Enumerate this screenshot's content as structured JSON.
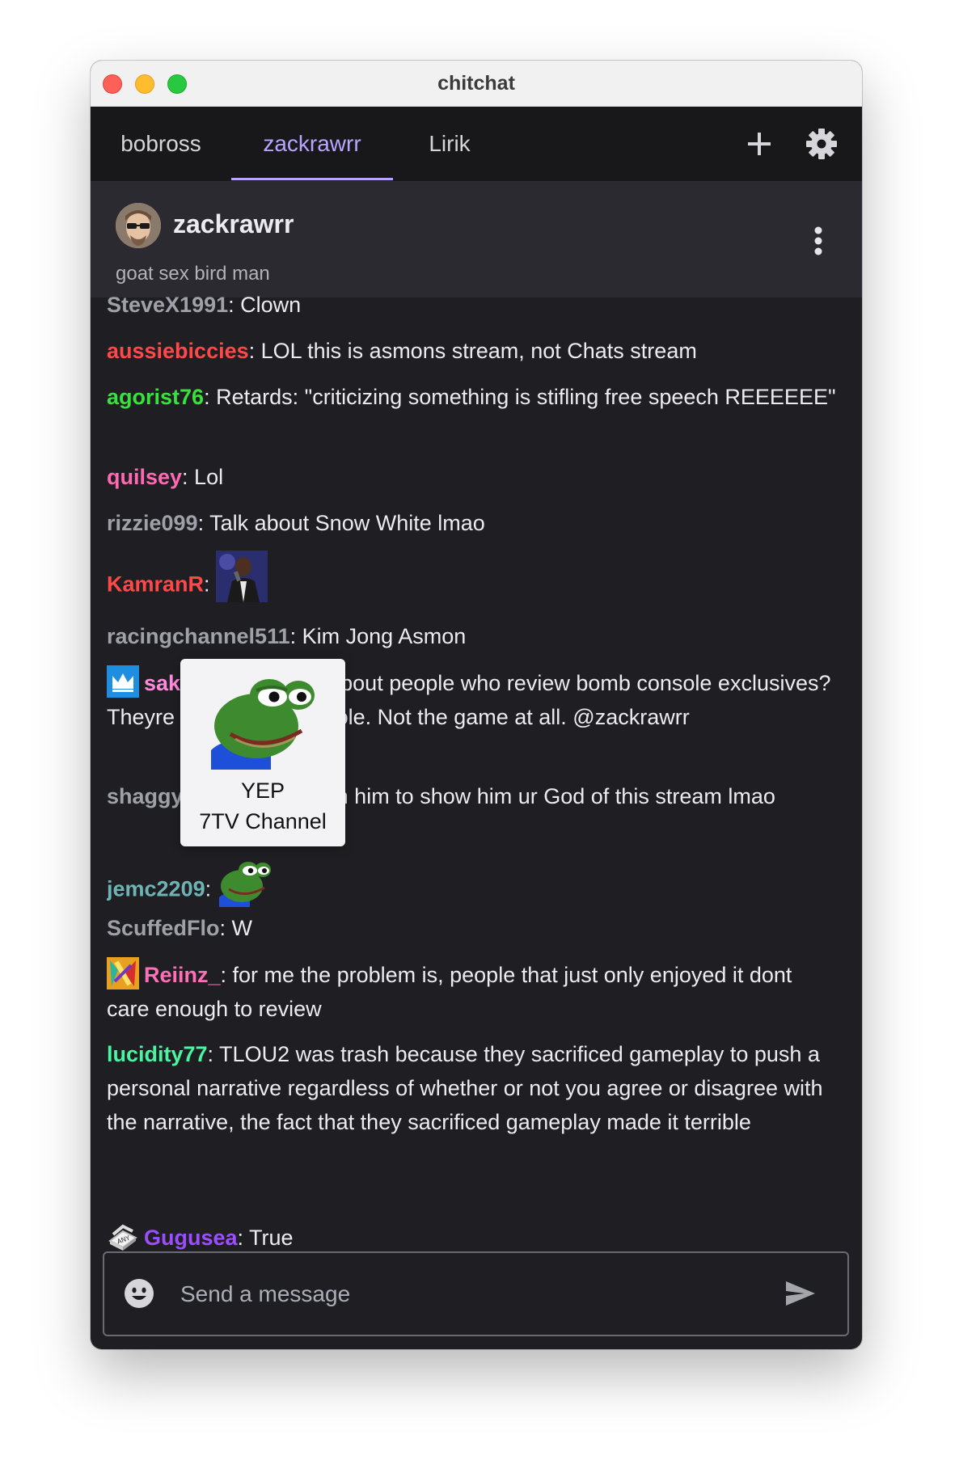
{
  "window": {
    "title": "chitchat"
  },
  "tabs": [
    {
      "label": "bobross"
    },
    {
      "label": "zackrawrr",
      "active": true
    },
    {
      "label": "Lirik"
    }
  ],
  "toolbar": {
    "add_icon": "plus-icon",
    "settings_icon": "gear-icon"
  },
  "channel": {
    "name": "zackrawrr",
    "title": "goat sex bird man",
    "menu_icon": "kebab-menu-icon"
  },
  "messages": [
    {
      "user": "SteveX1991",
      "color": "#a0a0a8",
      "text": ": Clown"
    },
    {
      "user": "aussiebiccies",
      "color": "#ff4848",
      "text": ": LOL this is asmons stream, not Chats stream"
    },
    {
      "user": "agorist76",
      "color": "#38e23a",
      "text": ": Retards: \"criticizing something is stifling free speech REEEEEE\""
    },
    {
      "user": "quilsey",
      "color": "#ff69b4",
      "text": ": Lol"
    },
    {
      "user": "rizzie099",
      "color": "#a0a0a8",
      "text": ": Talk about Snow White lmao"
    },
    {
      "user": "KamranR",
      "color": "#ff4848",
      "text": ":",
      "emote": "man-with-microphone-emote"
    },
    {
      "user": "racingchannel511",
      "color": "#a0a0a8",
      "text": ": Kim Jong Asmon"
    },
    {
      "user": "sakura",
      "color": "#ff8adb",
      "text": ": Now what about people who review bomb console exclusives? Theyre mad at the console. Not the game at all. @zackrawrr",
      "badge": "crown-badge"
    },
    {
      "user": "shaggykilla",
      "color": "#a0a0a8",
      "text": ": Now unban him to show him ur God of this stream lmao"
    },
    {
      "user": "jemc2209",
      "color": "#6fb4b5",
      "text": ":",
      "emote": "yep-frog-emote"
    },
    {
      "user": "ScuffedFlo",
      "color": "#a0a0a8",
      "text": ": W"
    },
    {
      "user": "Reiinz_",
      "color": "#ff6fb5",
      "text": ": for me the problem is, people that just only enjoyed it dont care enough to review",
      "badge": "artist-badge"
    },
    {
      "user": "lucidity77",
      "color": "#48f5a0",
      "text": ": TLOU2 was trash because they sacrificed gameplay to push a personal narrative regardless of whether or not you agree or disagree with the narrative, the fact that they sacrificed gameplay made it terrible"
    },
    {
      "user": "Gugusea",
      "color": "#9b4dff",
      "text": ": True",
      "badge": "any-badge"
    }
  ],
  "tooltip": {
    "emote_name": "YEP",
    "source": "7TV Channel"
  },
  "composer": {
    "placeholder": "Send a message",
    "emoji_icon": "smiley-icon",
    "send_icon": "send-icon"
  }
}
